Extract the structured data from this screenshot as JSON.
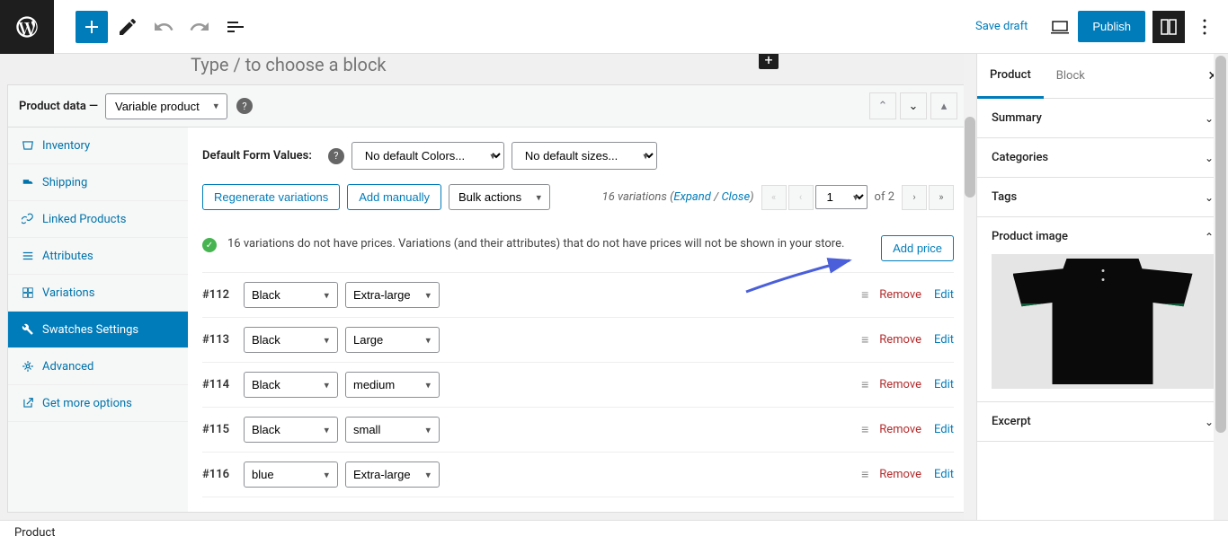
{
  "topbar": {
    "save_draft": "Save draft",
    "publish": "Publish"
  },
  "block_hint": "Type / to choose a block",
  "product_data": {
    "label": "Product data —",
    "type": "Variable product",
    "tabs": [
      {
        "id": "inventory",
        "label": "Inventory",
        "icon": "box"
      },
      {
        "id": "shipping",
        "label": "Shipping",
        "icon": "truck"
      },
      {
        "id": "linked",
        "label": "Linked Products",
        "icon": "link"
      },
      {
        "id": "attributes",
        "label": "Attributes",
        "icon": "list"
      },
      {
        "id": "variations",
        "label": "Variations",
        "icon": "grid"
      },
      {
        "id": "swatches",
        "label": "Swatches Settings",
        "icon": "wrench",
        "active": true
      },
      {
        "id": "advanced",
        "label": "Advanced",
        "icon": "gear"
      },
      {
        "id": "more",
        "label": "Get more options",
        "icon": "external"
      }
    ]
  },
  "form": {
    "default_label": "Default Form Values:",
    "default_colors": "No default Colors...",
    "default_sizes": "No default sizes..."
  },
  "toolbar": {
    "regenerate": "Regenerate variations",
    "add_manually": "Add manually",
    "bulk": "Bulk actions",
    "count_text": "16 variations",
    "expand": "Expand",
    "close": "Close",
    "page": "1",
    "of": "of 2"
  },
  "notice": {
    "text": "16 variations do not have prices. Variations (and their attributes) that do not have prices will not be shown in your store.",
    "add_price": "Add price"
  },
  "variations": [
    {
      "id": "#112",
      "color": "Black",
      "size": "Extra-large"
    },
    {
      "id": "#113",
      "color": "Black",
      "size": "Large"
    },
    {
      "id": "#114",
      "color": "Black",
      "size": "medium"
    },
    {
      "id": "#115",
      "color": "Black",
      "size": "small"
    },
    {
      "id": "#116",
      "color": "blue",
      "size": "Extra-large"
    }
  ],
  "row_actions": {
    "remove": "Remove",
    "edit": "Edit"
  },
  "sidebar": {
    "tabs": {
      "product": "Product",
      "block": "Block"
    },
    "panels": {
      "summary": "Summary",
      "categories": "Categories",
      "tags": "Tags",
      "product_image": "Product image",
      "excerpt": "Excerpt"
    }
  },
  "statusbar": "Product"
}
